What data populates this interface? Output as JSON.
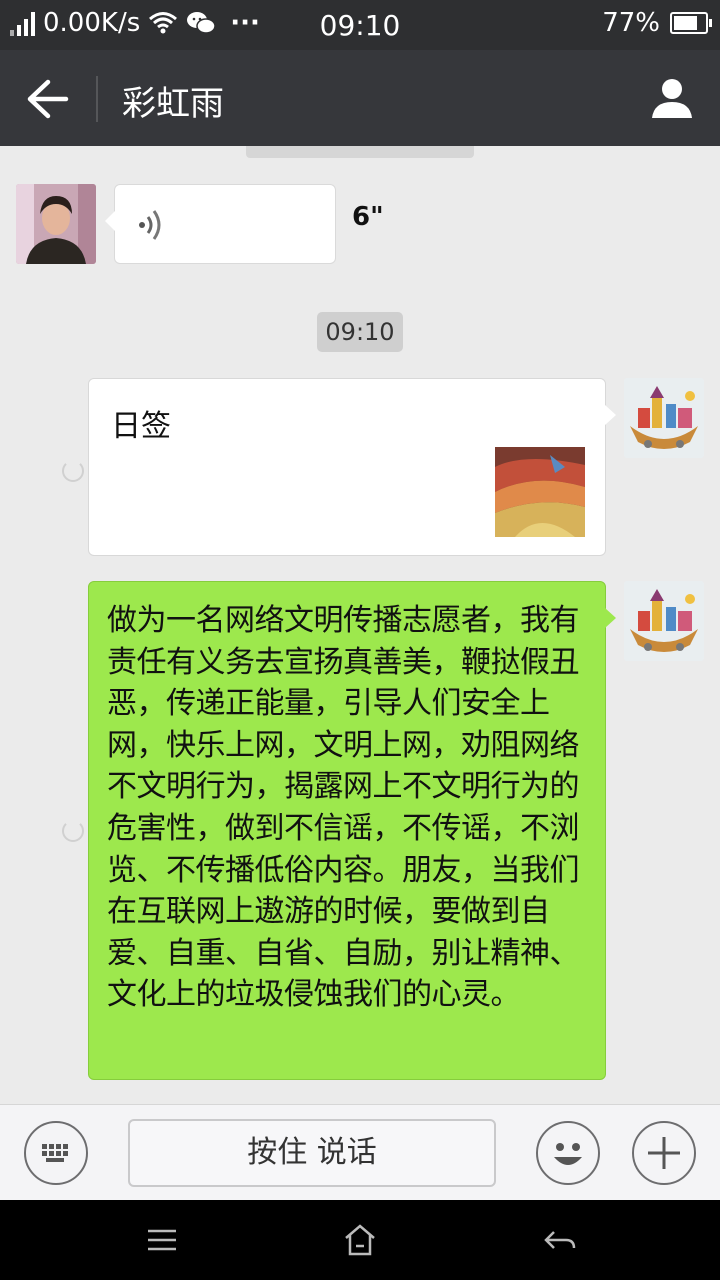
{
  "status_bar": {
    "net_speed": "0.00K/s",
    "more": "···",
    "time": "09:10",
    "battery": "77%",
    "battery_level": 0.77
  },
  "header": {
    "title": "彩虹雨"
  },
  "messages": {
    "voice": {
      "duration": "6\""
    },
    "timestamp": "09:10",
    "share_card": {
      "title": "日签"
    },
    "text": "做为一名网络文明传播志愿者，我有责任有义务去宣扬真善美，鞭挞假丑恶，传递正能量，引导人们安全上网，快乐上网，文明上网，劝阻网络不文明行为，揭露网上不文明行为的危害性，做到不信谣，不传谣，不浏览、不传播低俗内容。朋友，当我们在互联网上遨游的时候，要做到自爱、自重、自省、自励，别让精神、文化上的垃圾侵蚀我们的心灵。"
  },
  "input_bar": {
    "hold_to_talk": "按住 说话"
  },
  "colors": {
    "header_bg": "#36373b",
    "status_bg": "#2e2f31",
    "chat_bg": "#ebebeb",
    "sent_bubble": "#9de84d"
  },
  "icons": {
    "back": "arrow-left-icon",
    "profile": "person-icon",
    "voice": "voice-wave-icon",
    "keyboard": "keyboard-icon",
    "emoji": "smiley-icon",
    "more": "plus-icon",
    "nav_menu": "menu-icon",
    "nav_home": "home-icon",
    "nav_back": "back-arrow-icon"
  }
}
